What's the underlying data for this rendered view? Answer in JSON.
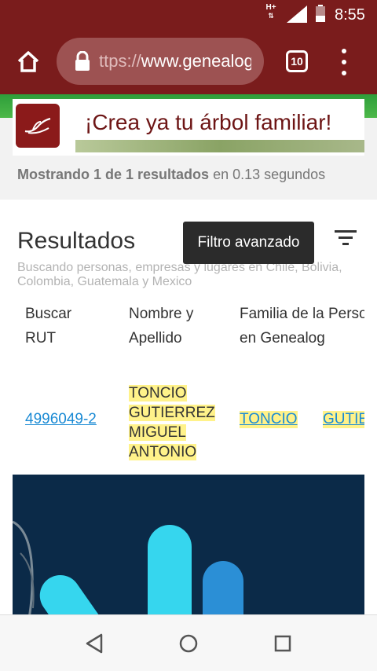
{
  "status_bar": {
    "network": "H+",
    "time": "8:55"
  },
  "browser": {
    "url_scheme": "ttps://",
    "url_host": "www.genealog",
    "tab_count": "10"
  },
  "banner": {
    "text": "¡Crea ya tu árbol familiar!"
  },
  "summary": {
    "bold": "Mostrando 1 de 1 resultados",
    "rest": " en 0.13 segundos"
  },
  "results": {
    "title": "Resultados",
    "tooltip": "Filtro avanzado",
    "description": "Buscando personas, empresas y lugares en Chile, Bolivia, Colombia, Guatemala y Mexico",
    "columns": [
      {
        "line1": "Buscar",
        "line2": "RUT"
      },
      {
        "line1": "Nombre y",
        "line2": "Apellido"
      },
      {
        "line1": "Familia de la Persona",
        "line2": "en Genealog"
      }
    ],
    "row": {
      "rut": "4996049-2",
      "name_lines": [
        "TONCIO",
        "GUTIERREZ",
        "MIGUEL",
        "ANTONIO"
      ],
      "family_links": [
        "TONCIO",
        "GUTIERREZ"
      ]
    }
  },
  "colors": {
    "chrome": "#7a1c1c",
    "url_bar": "#9d5252",
    "highlight": "#fff28a",
    "link": "#1a8ad4",
    "ad_background": "#0b2a48"
  },
  "icons": {
    "home": "home-icon",
    "lock": "lock-icon",
    "menu": "more-vert-icon",
    "filter": "filter-icon",
    "back": "back-triangle-icon",
    "home_nav": "home-circle-icon",
    "recents": "recents-square-icon"
  }
}
